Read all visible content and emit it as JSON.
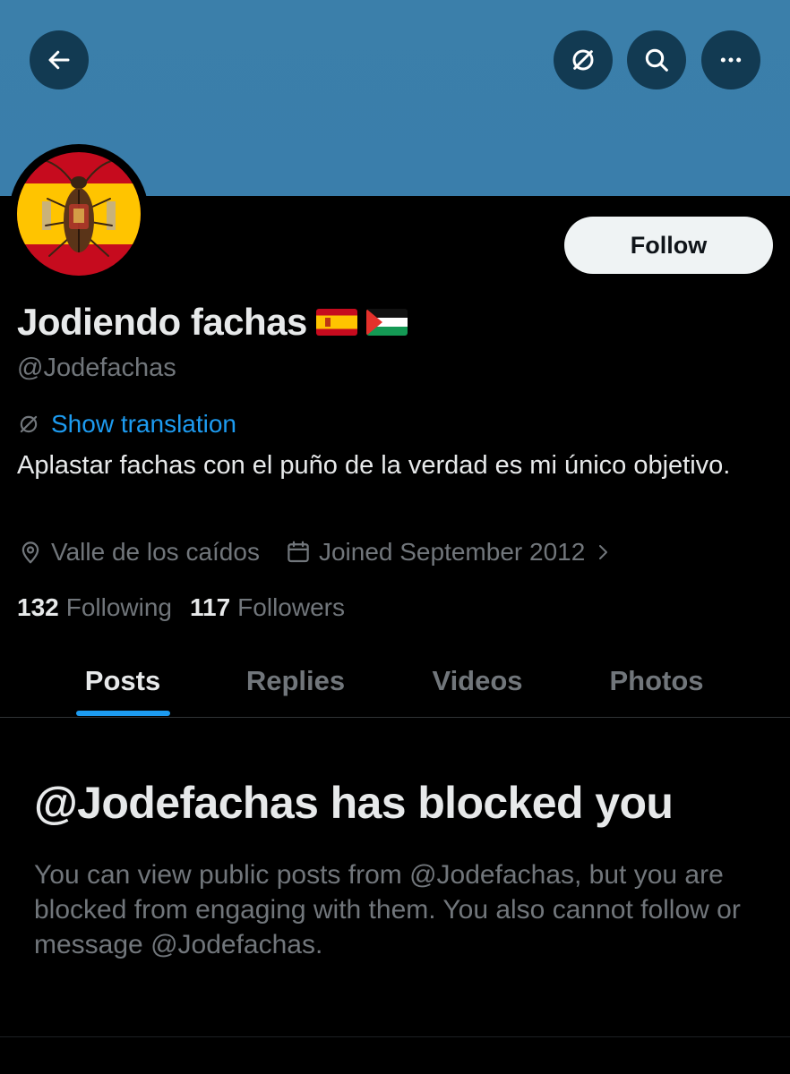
{
  "header": {
    "back_icon": "arrow-left-icon",
    "translate_icon": "translate-icon",
    "search_icon": "search-icon",
    "more_icon": "more-horizontal-icon",
    "banner_color": "#3b7faa"
  },
  "profile": {
    "display_name": "Jodiendo fachas",
    "flags": [
      "Spain flag emoji",
      "Palestine flag emoji"
    ],
    "handle": "@Jodefachas",
    "follow_label": "Follow",
    "translate_label": "Show translation",
    "bio": "Aplastar fachas con el puño de la verdad es mi único objetivo.",
    "location": "Valle de los caídos",
    "joined": "Joined September 2012",
    "following_count": "132",
    "following_label": "Following",
    "followers_count": "117",
    "followers_label": "Followers"
  },
  "tabs": [
    {
      "label": "Posts",
      "active": true
    },
    {
      "label": "Replies",
      "active": false
    },
    {
      "label": "Videos",
      "active": false
    },
    {
      "label": "Photos",
      "active": false
    }
  ],
  "blocked": {
    "title": "@Jodefachas has blocked you",
    "description": "You can view public posts from @Jodefachas, but you are blocked from engaging with them. You also cannot follow or message @Jodefachas."
  },
  "colors": {
    "accent": "#1d9bf0",
    "muted": "#71767b",
    "text": "#e7e9ea",
    "background": "#000000"
  }
}
